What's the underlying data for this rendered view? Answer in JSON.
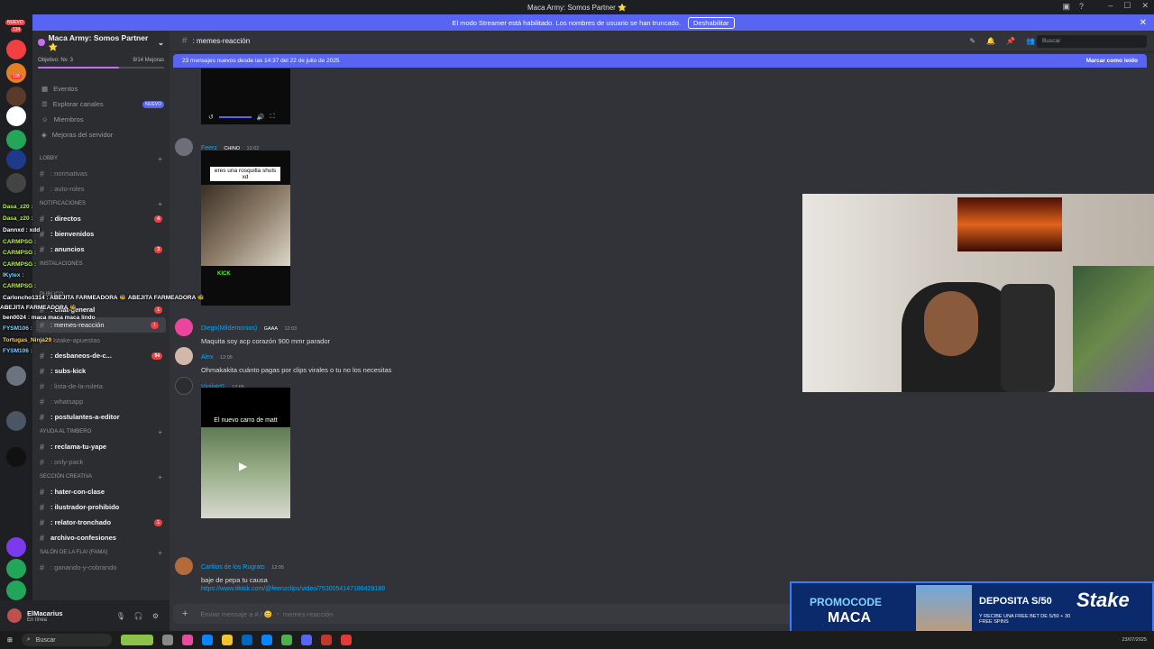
{
  "window": {
    "title": "Maca Army: Somos Partner ⭐"
  },
  "streamer_banner": {
    "text": "El modo Streamer está habilitado. Los nombres de usuario se han truncado.",
    "button": "Deshabilitar"
  },
  "rail": {
    "badge_new": "NUEVO",
    "badge_count": "134",
    "badge_2": "105"
  },
  "server": {
    "name": "Maca Army: Somos Partner ⭐",
    "boost_goal": "Objetivo: Nv. 3",
    "boost_progress": "9/14 Mejoras",
    "boost_fraction": 0.64
  },
  "nav": {
    "events": "Eventos",
    "browse": "Explorar canales",
    "browse_badge": "NUEVO",
    "members": "Miembros",
    "boosts": "Mejoras del servidor"
  },
  "categories": {
    "lobby": "LOBBY",
    "notificaciones": "NOTIFICACIONES",
    "instalaciones": "INSTALACIONES",
    "publico": "PUBLICO",
    "ayuda": "AYUDA AL TIMBERO",
    "creativa": "SECCIÓN CREATIVA",
    "salon": "SALÓN DE LA FLA! (FAMA)"
  },
  "channels": {
    "normativas": ": normativas",
    "autoroles": ": auto-roles",
    "directos": ": directos",
    "directos_count": "4",
    "bienvenidos": ": bienvenidos",
    "anuncios": ": anuncios",
    "anuncios_count": "3",
    "chat_general": ": chat-general",
    "chat_general_count": "1",
    "memes": ": memes-reacción",
    "memes_count": "1",
    "stake": ": stake-apuestas",
    "desbaneos": ": desbaneos-de-c...",
    "desbaneos_count": "94",
    "subs_kick": ": subs-kick",
    "ruleta": ": lista-de-la-ruleta",
    "whatsapp": ": whatsapp",
    "postulantes": ": postulantes-a-editor",
    "reclama": ": reclama-tu-yape",
    "only_pack": ": only-pack",
    "hater": ": hater-con-clase",
    "ilustrador": ": ilustrador-prohibido",
    "relator": ": relator-tronchado",
    "relator_count": "1",
    "archivo": "archivo-confesiones",
    "ganando": ": ganando-y-cobrando"
  },
  "user": {
    "name": "ElMacarius",
    "status": "En línea"
  },
  "chat_header": {
    "channel": ": memes-reacción",
    "search_placeholder": "Buscar"
  },
  "new_messages": {
    "text": "23 mensajes nuevos desde las 14:37 del 22 de julio de 2025",
    "mark": "Marcar como leído"
  },
  "messages": [
    {
      "author": "Feerz",
      "tag": "CHINO",
      "time": "12:02",
      "meme_caption": "eres una rosquilla shuls xd",
      "meme_footer": "KICK"
    },
    {
      "author": "Diego(Mildemonios)",
      "tag": "GAAA",
      "time": "12:03",
      "text": "Maquita soy acp corazón 900 mmr parador"
    },
    {
      "author": "Alex",
      "time": "12:05",
      "text": "Ohmakakita cuánto pagas por clips virales o tu no los  necesitas"
    },
    {
      "author": "Vigilatd1",
      "time": "12:05",
      "video_caption": "El nuevo carro de matt"
    },
    {
      "author": "Carlitos de los Rugrats",
      "time": "12:05",
      "text": "baje de pepa tu causa",
      "link": "https://www.tiktok.com/@feenzclips/video/7530054147186429189"
    }
  ],
  "composer": {
    "placeholder": "Enviar mensaje a # / 😊 ・ memes-reacción"
  },
  "taskbar": {
    "search": "Buscar",
    "date": "23/07/2025"
  },
  "stream_chat": [
    "Dasa_z20 :",
    "Dasa_z20 :",
    "Dannxd : xdd",
    "CARMPSG :",
    "CARMPSG :",
    "CARMPSG :",
    "IKytex :",
    "CARMPSG :",
    "Carloncho1314 : ABEJITA FARMEADORA 🐝 ABEJITA FARMEADORA 🐝",
    "ABEJITA FARMEADORA 🐝",
    "ben0024 : maca maca maca lindo",
    "FYSM106 :",
    "Tortugas_Ninja29 :",
    "FYSM106 :"
  ],
  "promo": {
    "line1": "PROMOCODE",
    "line2": "MACA",
    "deposit": "DEPOSITA S/50",
    "offer": "Y RECIBE UNA FREE BET DE S/50 + 30 FREE SPINS",
    "brand": "Stake"
  },
  "colors": {
    "accent": "#5865f2",
    "boost": "#c770f3",
    "link": "#00a8fc",
    "mention": "#f23f43"
  }
}
